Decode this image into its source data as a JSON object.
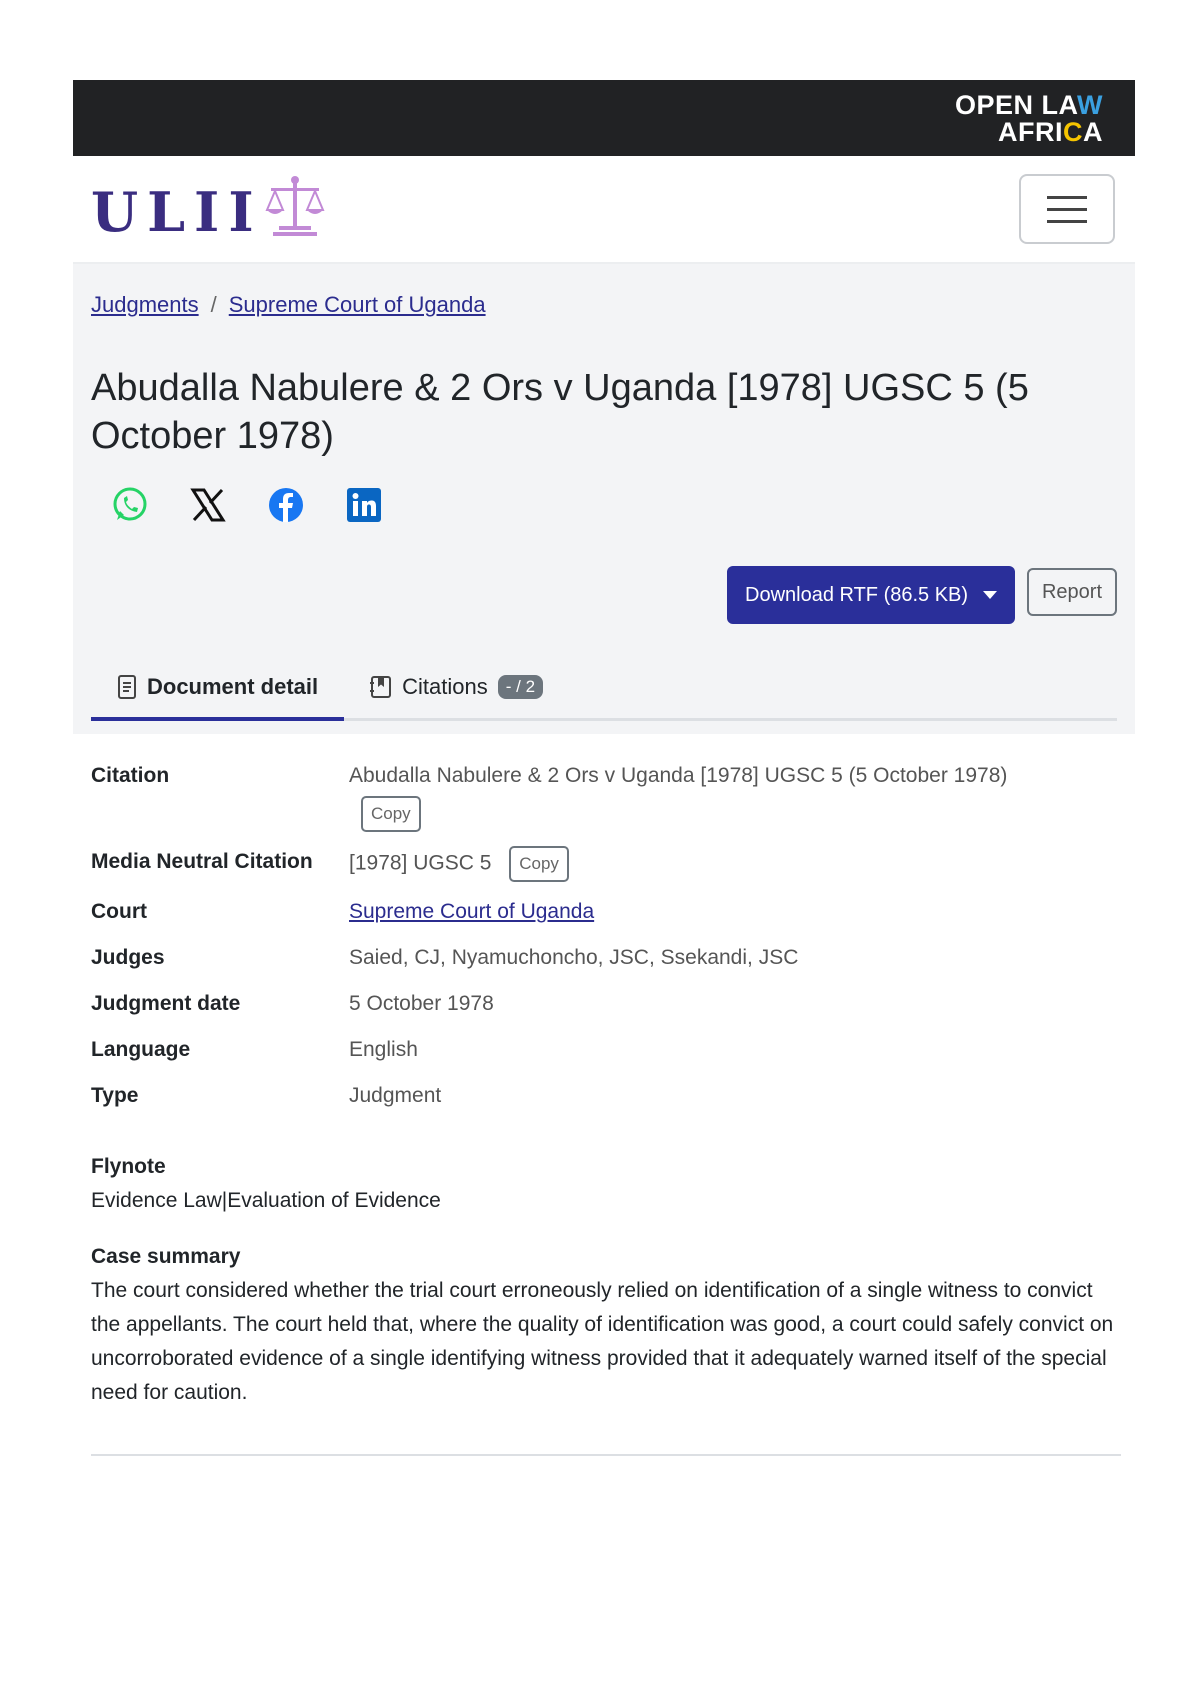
{
  "topbar": {
    "logo_line1_a": "OPEN LA",
    "logo_line1_b": "W",
    "logo_line2_a": "AFRI",
    "logo_line2_b": "C",
    "logo_line2_c": "A"
  },
  "navbar": {
    "brand": "ULII",
    "brand_icon": "scales-icon",
    "menu_icon": "hamburger-icon"
  },
  "breadcrumb": {
    "items": [
      "Judgments",
      "Supreme Court of Uganda"
    ],
    "separator": "/"
  },
  "document": {
    "title": "Abudalla Nabulere & 2 Ors v Uganda [1978] UGSC 5 (5 October 1978)"
  },
  "share": {
    "icons": [
      "whatsapp-icon",
      "x-icon",
      "facebook-icon",
      "linkedin-icon"
    ]
  },
  "actions": {
    "download_label": "Download RTF (86.5 KB)",
    "report_label": "Report"
  },
  "tabs": [
    {
      "label": "Document detail",
      "icon": "document-icon"
    },
    {
      "label": "Citations",
      "icon": "bookmark-icon",
      "badge": "- / 2"
    }
  ],
  "details": {
    "citation_label": "Citation",
    "citation_value": "Abudalla Nabulere & 2 Ors v Uganda [1978] UGSC 5 (5 October 1978)",
    "copy_label": "Copy",
    "mnc_label": "Media Neutral Citation",
    "mnc_value": "[1978] UGSC 5",
    "court_label": "Court",
    "court_value": "Supreme Court of Uganda",
    "judges_label": "Judges",
    "judges_value": "Saied, CJ, Nyamuchoncho, JSC, Ssekandi, JSC",
    "date_label": "Judgment date",
    "date_value": "5 October 1978",
    "language_label": "Language",
    "language_value": "English",
    "type_label": "Type",
    "type_value": "Judgment"
  },
  "flynote": {
    "heading": "Flynote",
    "body": "Evidence Law|Evaluation of Evidence"
  },
  "case_summary": {
    "heading": "Case summary",
    "body": "The court considered whether the trial court erroneously relied on identification of a single witness to convict the appellants. The court held that, where the quality of identification was good, a court could safely convict on uncorroborated evidence of a single identifying witness provided that it adequately warned itself of the special need for caution."
  },
  "colors": {
    "primary": "#2a2f9a",
    "brand": "#3a2d80",
    "topbar": "#212224",
    "header_bg": "#f3f4f6"
  }
}
